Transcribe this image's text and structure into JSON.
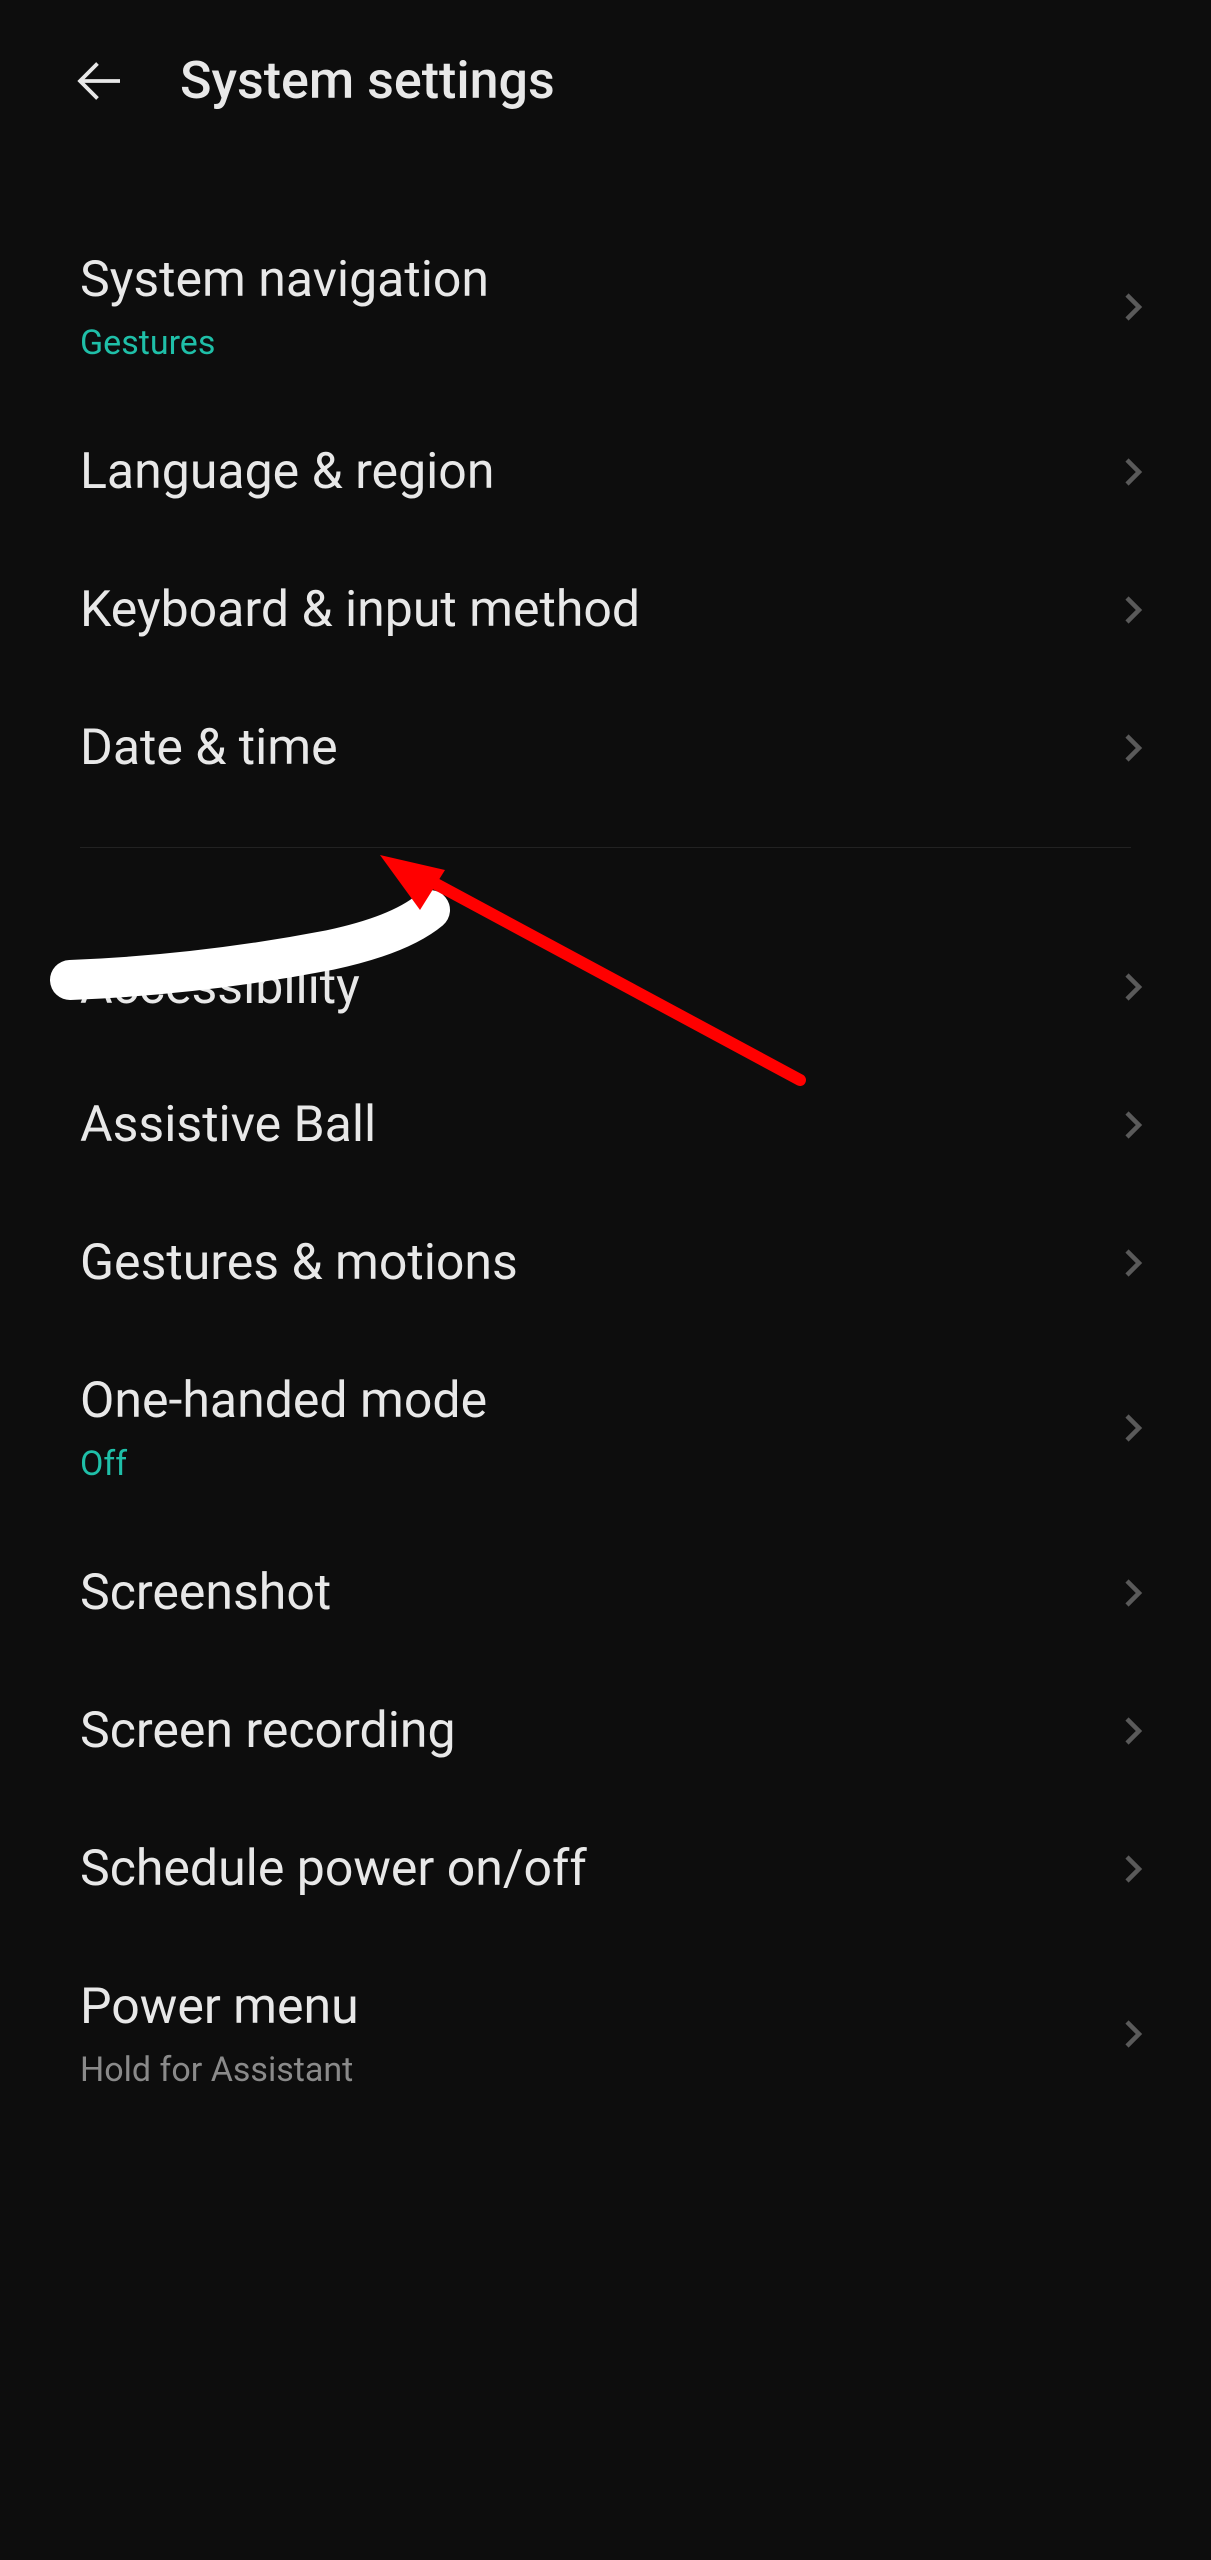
{
  "header": {
    "title": "System settings"
  },
  "groups": [
    {
      "items": [
        {
          "label": "System navigation",
          "sub": "Gestures",
          "subStyle": "teal"
        },
        {
          "label": "Language & region"
        },
        {
          "label": "Keyboard & input method"
        },
        {
          "label": "Date & time"
        }
      ]
    },
    {
      "items": [
        {
          "label": "Accessibility"
        },
        {
          "label": "Assistive Ball"
        },
        {
          "label": "Gestures & motions"
        },
        {
          "label": "One-handed mode",
          "sub": "Off",
          "subStyle": "teal"
        },
        {
          "label": "Screenshot"
        },
        {
          "label": "Screen recording"
        },
        {
          "label": "Schedule power on/off"
        },
        {
          "label": "Power menu",
          "sub": "Hold for Assistant",
          "subStyle": "gray"
        }
      ]
    }
  ]
}
